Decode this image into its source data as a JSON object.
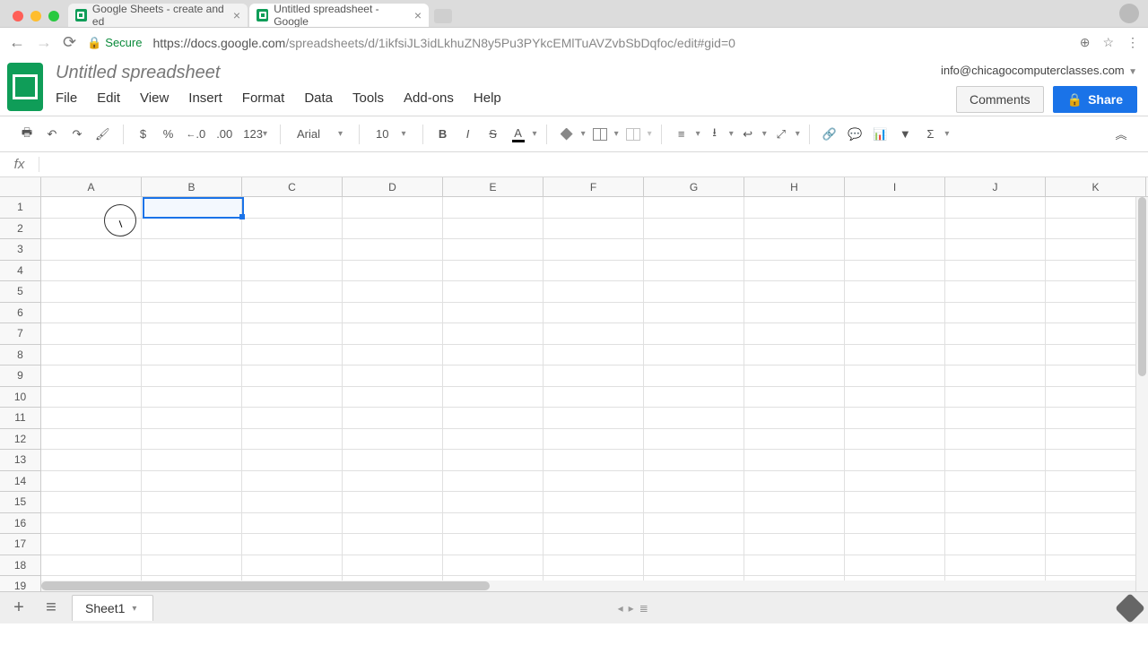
{
  "browser": {
    "tabs": [
      {
        "title": "Google Sheets - create and ed",
        "active": false
      },
      {
        "title": "Untitled spreadsheet - Google",
        "active": true
      }
    ],
    "secure_label": "Secure",
    "url_host": "https://docs.google.com",
    "url_path": "/spreadsheets/d/1ikfsiJL3idLkhuZN8y5Pu3PYkcEMlTuAVZvbSbDqfoc/edit#gid=0"
  },
  "doc": {
    "title": "Untitled spreadsheet",
    "user_email": "info@chicagocomputerclasses.com",
    "comments_label": "Comments",
    "share_label": "Share"
  },
  "menu": {
    "file": "File",
    "edit": "Edit",
    "view": "View",
    "insert": "Insert",
    "format": "Format",
    "data": "Data",
    "tools": "Tools",
    "addons": "Add-ons",
    "help": "Help"
  },
  "toolbar": {
    "currency": "$",
    "percent": "%",
    "dec_dec": ".0",
    "inc_dec": ".00",
    "more_formats": "123",
    "font": "Arial",
    "font_size": "10",
    "bold": "B",
    "italic": "I",
    "strike": "S",
    "text_color": "A"
  },
  "formula": {
    "fx": "fx",
    "value": ""
  },
  "grid": {
    "columns": [
      "A",
      "B",
      "C",
      "D",
      "E",
      "F",
      "G",
      "H",
      "I",
      "J",
      "K"
    ],
    "rows": [
      "1",
      "2",
      "3",
      "4",
      "5",
      "6",
      "7",
      "8",
      "9",
      "10",
      "11",
      "12",
      "13",
      "14",
      "15",
      "16",
      "17",
      "18",
      "19"
    ],
    "selected": {
      "col": "B",
      "row": "1"
    }
  },
  "sheets": {
    "active": "Sheet1"
  }
}
